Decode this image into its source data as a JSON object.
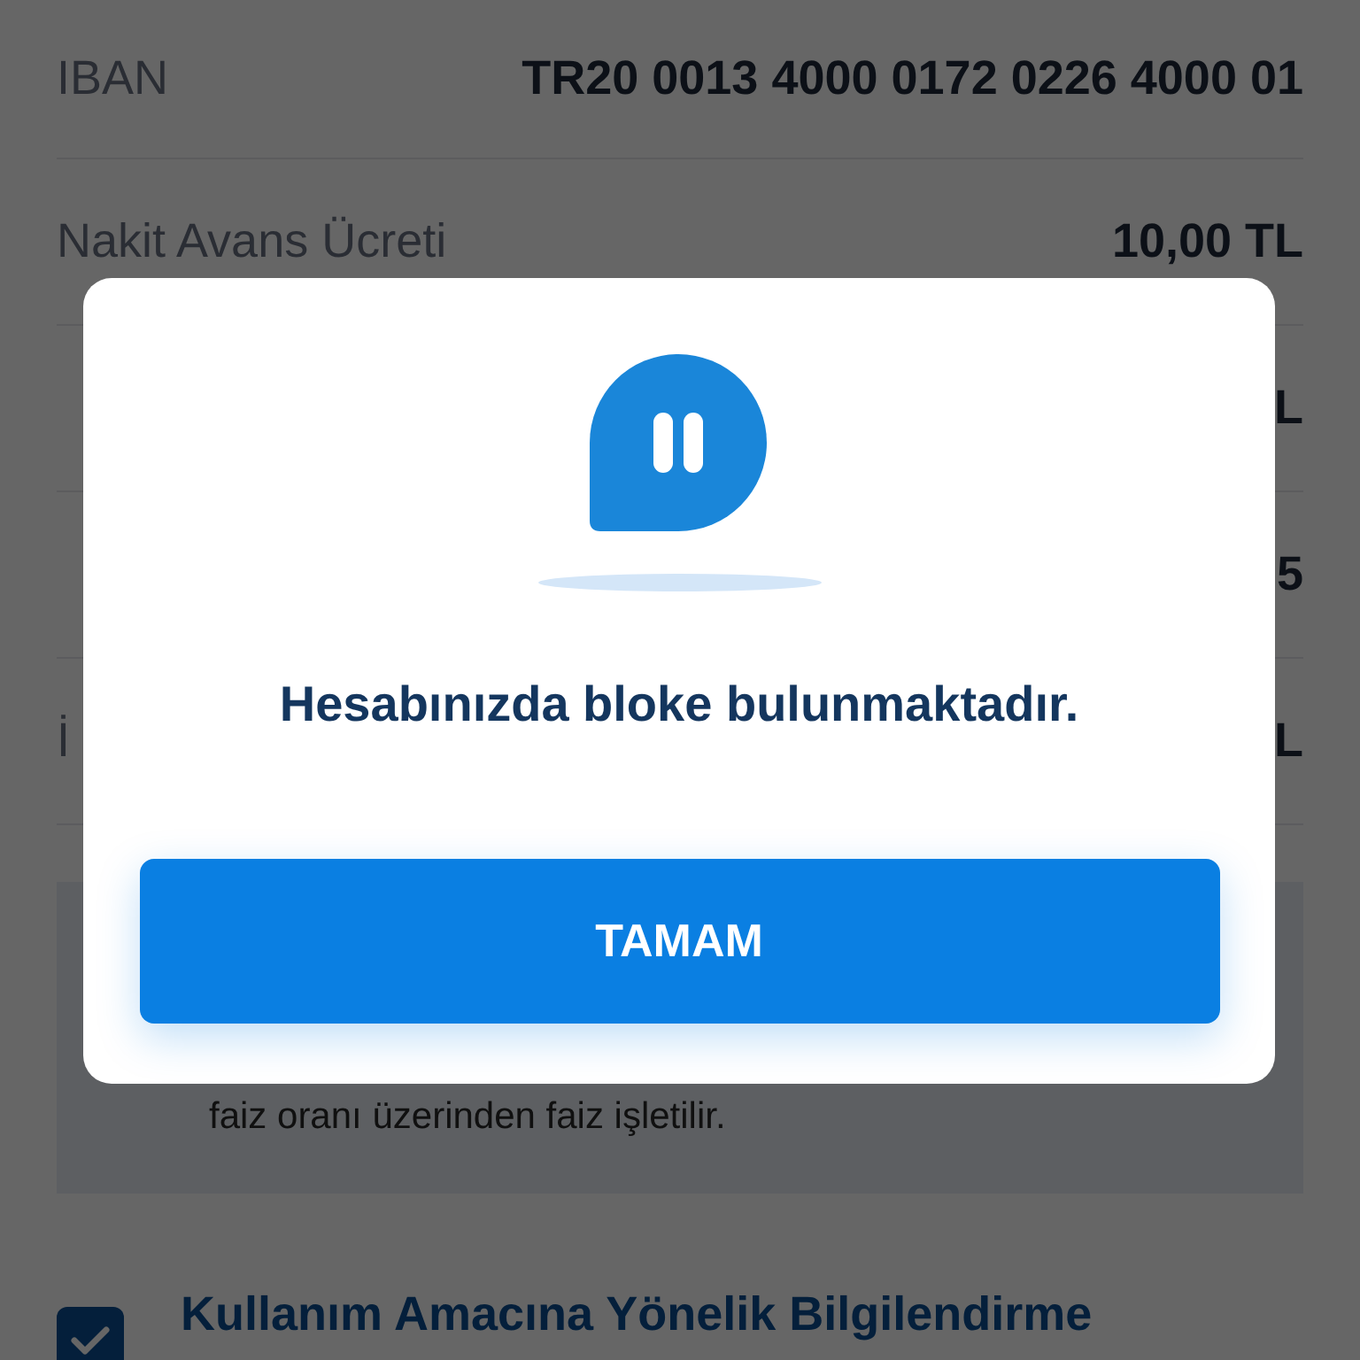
{
  "rows": [
    {
      "label": "IBAN",
      "value": "TR20 0013 4000 0172 0226 4000 01"
    },
    {
      "label": "Nakit Avans Ücreti",
      "value": "10,00 TL"
    },
    {
      "value": "L"
    },
    {
      "value": "5"
    },
    {
      "label": "İ",
      "value": "L"
    }
  ],
  "info_text": "faiz oranı üzerinden faiz işletilir.",
  "consent": {
    "checked": true,
    "link": "Kullanım Amacına Yönelik Bilgilendirme"
  },
  "dialog": {
    "message": "Hesabınızda bloke bulunmaktadır.",
    "button": "TAMAM"
  }
}
